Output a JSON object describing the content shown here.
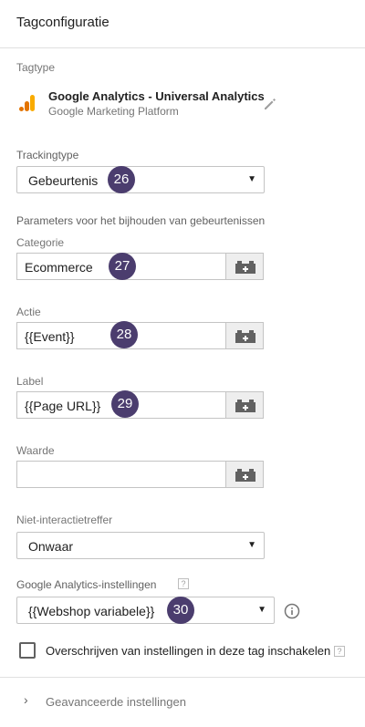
{
  "header": {
    "title": "Tagconfiguratie"
  },
  "tagtype": {
    "label": "Tagtype",
    "name": "Google Analytics - Universal Analytics",
    "platform": "Google Marketing Platform",
    "icon": "analytics-bar-icon",
    "accent_colors": [
      "#f9ab00",
      "#e37400"
    ]
  },
  "tracking": {
    "label": "Trackingtype",
    "value": "Gebeurtenis",
    "badge": "26"
  },
  "params": {
    "heading": "Parameters voor het bijhouden van gebeurtenissen",
    "categorie": {
      "label": "Categorie",
      "value": "Ecommerce",
      "badge": "27"
    },
    "actie": {
      "label": "Actie",
      "value": "{{Event}}",
      "badge": "28"
    },
    "label_field": {
      "label": "Label",
      "value": "{{Page URL}}",
      "badge": "29"
    },
    "waarde": {
      "label": "Waarde",
      "value": ""
    }
  },
  "non_interaction": {
    "label": "Niet-interactietreffer",
    "value": "Onwaar"
  },
  "ga_settings": {
    "label": "Google Analytics-instellingen",
    "help": "?",
    "value": "{{Webshop variabele}}",
    "badge": "30"
  },
  "override": {
    "label": "Overschrijven van instellingen in deze tag inschakelen",
    "help": "?",
    "checked": false
  },
  "advanced": {
    "label": "Geavanceerde instellingen"
  },
  "colors": {
    "badge": "#4b3d6e",
    "border": "#c4c4c4",
    "var_button": "#eeeeee"
  }
}
